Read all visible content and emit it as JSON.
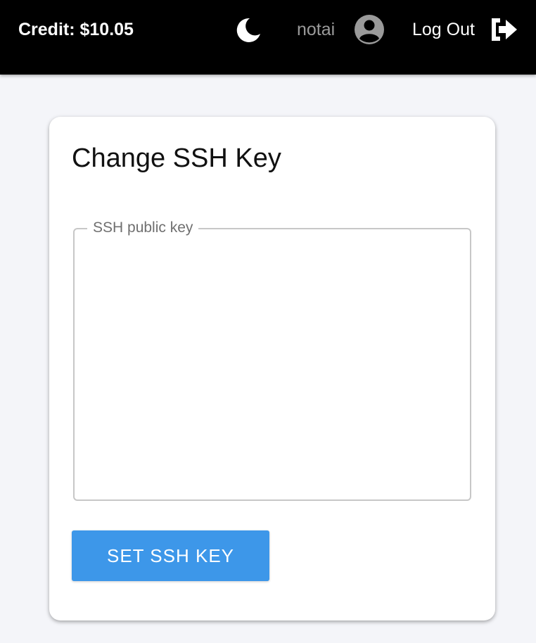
{
  "header": {
    "credit_label": "Credit: $10.05",
    "username": "notai",
    "logout_label": "Log Out",
    "theme_toggle_icon": "moon-icon",
    "avatar_icon": "user-circle-icon",
    "logout_icon": "sign-out-icon"
  },
  "card": {
    "title": "Change SSH Key",
    "ssh_field": {
      "label": "SSH public key",
      "value": ""
    },
    "submit_label": "SET SSH KEY"
  },
  "colors": {
    "header_bg": "#000000",
    "page_bg": "#f4f5f9",
    "button_bg": "#3d97e9",
    "username_text": "#9a9a9a"
  }
}
